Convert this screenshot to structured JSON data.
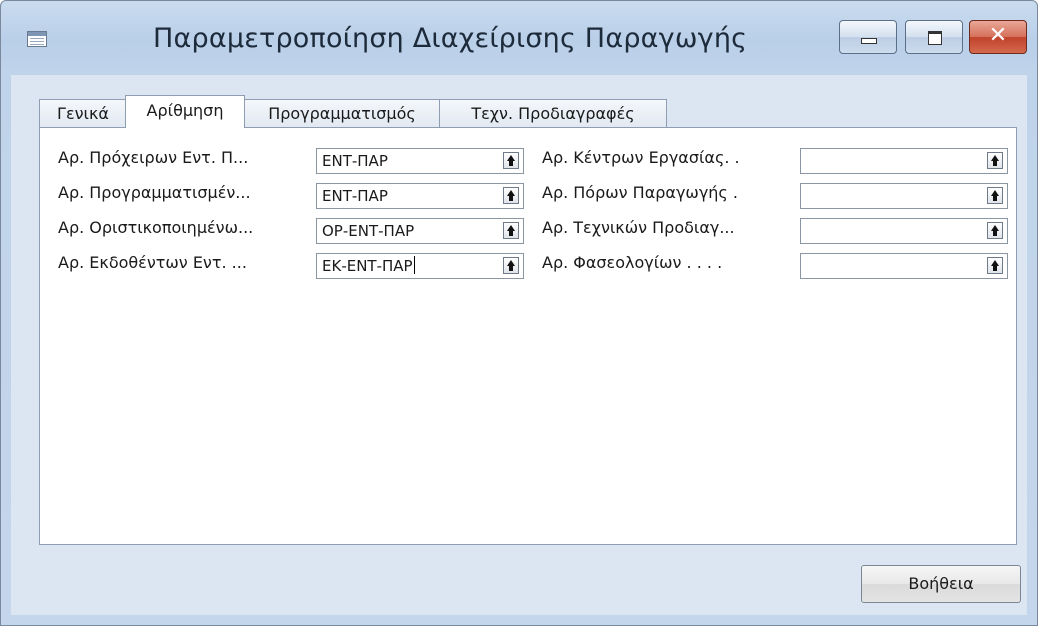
{
  "window": {
    "title": "Παραμετροποίηση Διαχείρισης Παραγωγής",
    "icons": {
      "app": "table-icon",
      "minimize": "minimize-icon",
      "maximize": "maximize-icon",
      "close": "close-icon"
    },
    "close_glyph": "✕"
  },
  "tabs": [
    {
      "label": "Γενικά"
    },
    {
      "label": "Αρίθμηση",
      "active": true
    },
    {
      "label": "Προγραμματισμός"
    },
    {
      "label": "Τεχν. Προδιαγραφές"
    }
  ],
  "left_fields": [
    {
      "label": "Αρ. Πρόχειρων Εντ. Π...",
      "value": "ΕΝΤ-ΠΑΡ"
    },
    {
      "label": "Αρ. Προγραμματισμέν...",
      "value": "ΕΝΤ-ΠΑΡ"
    },
    {
      "label": "Αρ. Οριστικοποιημένω...",
      "value": "ΟΡ-ΕΝΤ-ΠΑΡ"
    },
    {
      "label": "Αρ. Εκδοθέντων Εντ. ...",
      "value": "ΕΚ-ΕΝΤ-ΠΑΡ"
    }
  ],
  "right_fields": [
    {
      "label": "Αρ. Κέντρων Εργασίας. .",
      "value": ""
    },
    {
      "label": "Αρ. Πόρων Παραγωγής .",
      "value": ""
    },
    {
      "label": "Αρ. Τεχνικών Προδιαγ...",
      "value": ""
    },
    {
      "label": "Αρ. Φασεολογίων . . . .",
      "value": ""
    }
  ],
  "buttons": {
    "help": "Βοήθεια"
  },
  "colors": {
    "frame": "#c4d6eb",
    "client": "#dbe6f2",
    "close_button": "#c0432a"
  }
}
